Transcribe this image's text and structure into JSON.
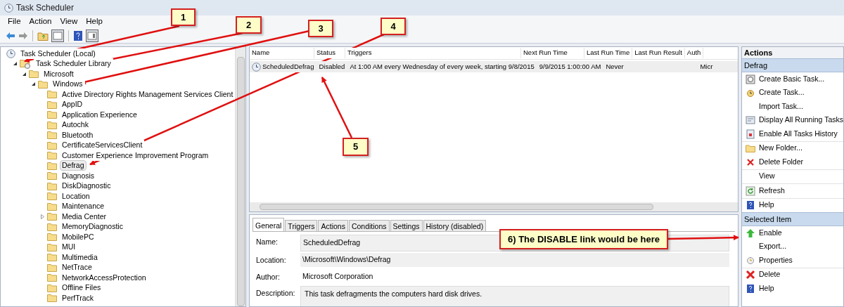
{
  "window": {
    "title": "Task Scheduler"
  },
  "menu": [
    "File",
    "Action",
    "View",
    "Help"
  ],
  "tree": [
    {
      "label": "Task Scheduler (Local)",
      "selected": false,
      "children": [
        {
          "label": "Task Scheduler Library",
          "selected": false,
          "expanded": true,
          "children": [
            {
              "label": "Microsoft",
              "selected": false,
              "expanded": true,
              "children": [
                {
                  "label": "Windows",
                  "selected": false,
                  "expanded": true,
                  "children": [
                    {
                      "label": "Active Directory Rights Management Services Client",
                      "selected": false
                    },
                    {
                      "label": "AppID",
                      "selected": false
                    },
                    {
                      "label": "Application Experience",
                      "selected": false
                    },
                    {
                      "label": "Autochk",
                      "selected": false
                    },
                    {
                      "label": "Bluetooth",
                      "selected": false
                    },
                    {
                      "label": "CertificateServicesClient",
                      "selected": false
                    },
                    {
                      "label": "Customer Experience Improvement Program",
                      "selected": false
                    },
                    {
                      "label": "Defrag",
                      "selected": true
                    },
                    {
                      "label": "Diagnosis",
                      "selected": false
                    },
                    {
                      "label": "DiskDiagnostic",
                      "selected": false
                    },
                    {
                      "label": "Location",
                      "selected": false
                    },
                    {
                      "label": "Maintenance",
                      "selected": false
                    },
                    {
                      "label": "Media Center",
                      "selected": false,
                      "expanded": false
                    },
                    {
                      "label": "MemoryDiagnostic",
                      "selected": false
                    },
                    {
                      "label": "MobilePC",
                      "selected": false
                    },
                    {
                      "label": "MUI",
                      "selected": false
                    },
                    {
                      "label": "Multimedia",
                      "selected": false
                    },
                    {
                      "label": "NetTrace",
                      "selected": false
                    },
                    {
                      "label": "NetworkAccessProtection",
                      "selected": false
                    },
                    {
                      "label": "Offline Files",
                      "selected": false
                    },
                    {
                      "label": "PerfTrack",
                      "selected": false
                    }
                  ]
                }
              ]
            }
          ]
        }
      ]
    }
  ],
  "table": {
    "columns": [
      "Name",
      "Status",
      "Triggers",
      "Next Run Time",
      "Last Run Time",
      "Last Run Result",
      "Auth"
    ],
    "rows": [
      {
        "selected": true,
        "cells": [
          "ScheduledDefrag",
          "Disabled",
          "At 1:00 AM every Wednesday of every week, starting 9/8/2015",
          "9/9/2015 1:00:00 AM",
          "Never",
          "",
          "Micr"
        ]
      }
    ]
  },
  "detail_tabs": [
    {
      "label": "General",
      "selected": true
    },
    {
      "label": "Triggers",
      "selected": false
    },
    {
      "label": "Actions",
      "selected": false
    },
    {
      "label": "Conditions",
      "selected": false
    },
    {
      "label": "Settings",
      "selected": false
    },
    {
      "label": "History (disabled)",
      "selected": false
    }
  ],
  "fields": [
    {
      "label": "Name:",
      "value": "ScheduledDefrag",
      "kind": "box"
    },
    {
      "label": "Location:",
      "value": "\\Microsoft\\Windows\\Defrag",
      "kind": "plain"
    },
    {
      "label": "Author:",
      "value": "Microsoft Corporation",
      "kind": "plain"
    },
    {
      "label": "Description:",
      "value": "This task defragments the computers hard disk drives.",
      "kind": "area"
    }
  ],
  "actions": {
    "title": "Actions",
    "sections": [
      {
        "title": "Defrag",
        "groups": [
          [
            "Create Basic Task...",
            "Create Task...",
            "Import Task...",
            "Display All Running Tasks",
            "Enable All Tasks History"
          ],
          [
            "New Folder...",
            "Delete Folder"
          ],
          [
            "View"
          ],
          [
            "Refresh"
          ],
          [
            "Help"
          ]
        ]
      },
      {
        "title": "Selected Item",
        "groups": [
          [
            "Enable",
            "Export...",
            "Properties"
          ],
          [
            "Delete",
            "Help"
          ]
        ]
      }
    ]
  },
  "callouts": [
    "1",
    "2",
    "3",
    "4",
    "5",
    "6) The DISABLE link would be here"
  ]
}
